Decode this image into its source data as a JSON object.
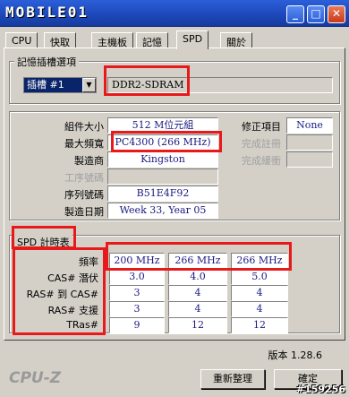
{
  "titlebar": {
    "logo": "MOBILE01",
    "min": "_",
    "max": "□",
    "close": "✕"
  },
  "tabs": [
    "CPU",
    "快取",
    "主機板",
    "記憶",
    "SPD",
    "關於"
  ],
  "slot_group": {
    "title": "記憶插槽選項",
    "slot_value": "插槽 #1",
    "mem_type": "DDR2-SDRAM"
  },
  "module": {
    "size_label": "組件大小",
    "size_value": "512 M位元組",
    "max_bw_label": "最大頻寬",
    "max_bw_value": "PC4300 (266 MHz)",
    "mfr_label": "製造商",
    "mfr_value": "Kingston",
    "part_label": "工序號碼",
    "part_value": "",
    "serial_label": "序列號碼",
    "serial_value": "B51E4F92",
    "date_label": "製造日期",
    "date_value": "Week 33, Year 05",
    "corr_label": "修正項目",
    "corr_value": "None",
    "reg_label": "完成註冊",
    "reg_value": "",
    "buf_label": "完成緩衝",
    "buf_value": ""
  },
  "spd": {
    "title": "SPD 計時表",
    "row_labels": [
      "頻率",
      "CAS# 潛伏",
      "RAS# 到 CAS#",
      "RAS# 支援",
      "TRas#"
    ],
    "columns": [
      [
        "200 MHz",
        "3.0",
        "3",
        "3",
        "9"
      ],
      [
        "266 MHz",
        "4.0",
        "4",
        "4",
        "12"
      ],
      [
        "266 MHz",
        "5.0",
        "4",
        "4",
        "12"
      ]
    ]
  },
  "footer": {
    "version": "版本 1.28.6",
    "brand": "CPU-Z",
    "refresh": "重新整理",
    "ok": "確定",
    "watermark": "#159256"
  }
}
